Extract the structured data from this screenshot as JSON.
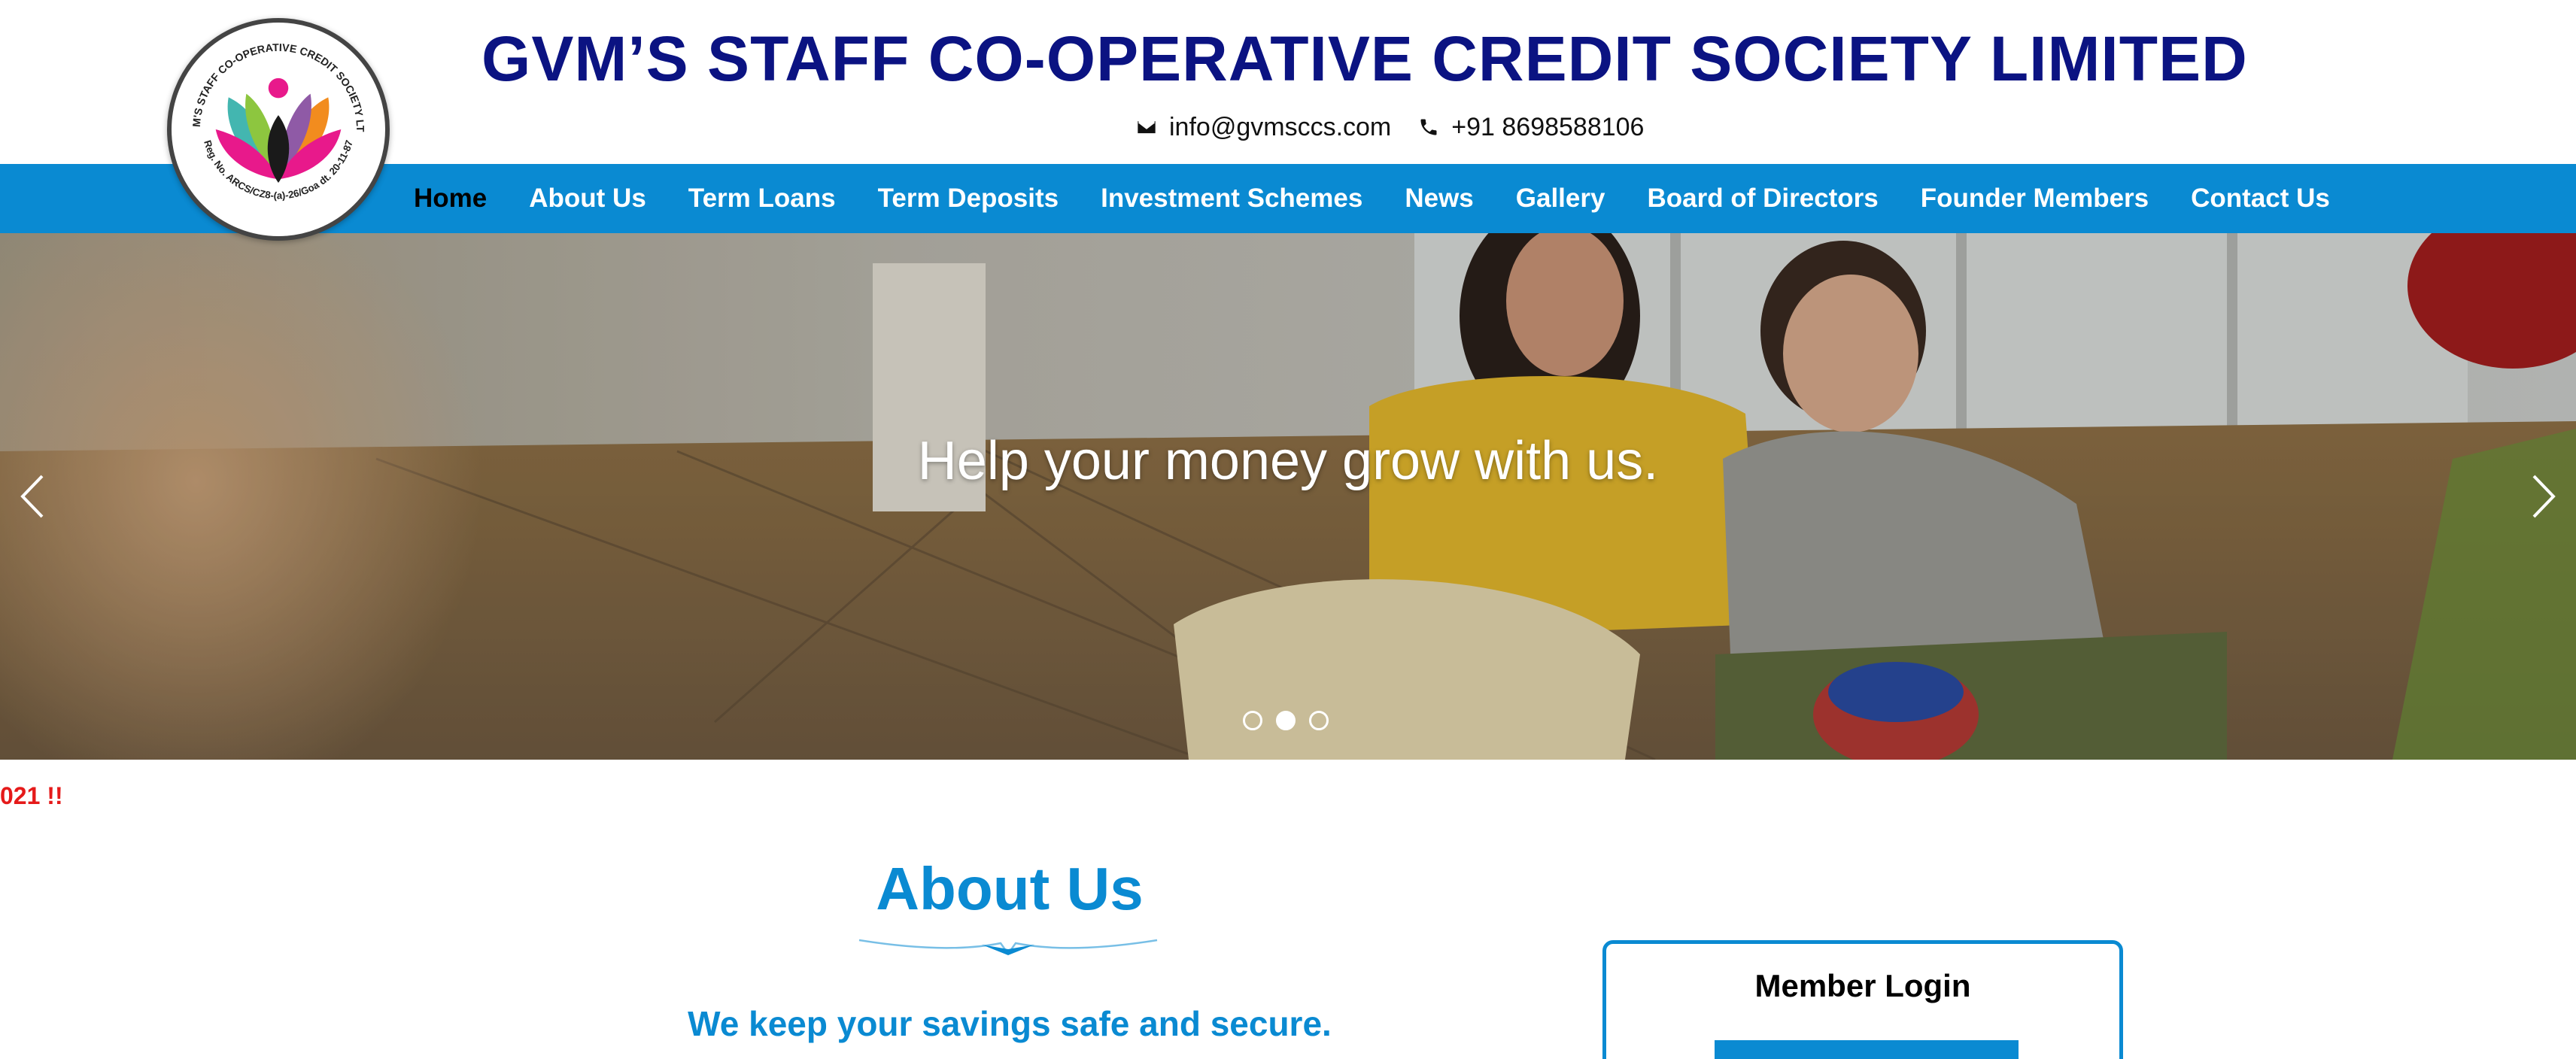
{
  "header": {
    "title": "GVM’S STAFF CO-OPERATIVE CREDIT SOCIETY LIMITED",
    "email": "info@gvmsccs.com",
    "phone": "+91 8698588106",
    "logo_text_top": "GVM'S STAFF CO-OPERATIVE CREDIT SOCIETY LTD.",
    "logo_text_bottom": "Reg. No. ARCS/CZ8-(a)-26/Goa dt. 20-11-87"
  },
  "nav": {
    "items": [
      {
        "label": "Home",
        "active": true
      },
      {
        "label": "About Us"
      },
      {
        "label": "Term Loans"
      },
      {
        "label": "Term Deposits"
      },
      {
        "label": "Investment Schemes"
      },
      {
        "label": "News"
      },
      {
        "label": "Gallery"
      },
      {
        "label": "Board of Directors"
      },
      {
        "label": "Founder Members"
      },
      {
        "label": "Contact Us"
      }
    ]
  },
  "hero": {
    "caption": "Help your money grow with us.",
    "slides": 3,
    "active_slide": 2
  },
  "marquee": {
    "text": "021 !!"
  },
  "about": {
    "title": "About Us",
    "subtitle": "We keep your savings safe and secure."
  },
  "login": {
    "title": "Member Login"
  },
  "colors": {
    "brand_blue": "#0a8ad2",
    "title_navy": "#0b1382",
    "marquee_red": "#e51a1a"
  },
  "icons": {
    "email": "envelope-icon",
    "phone": "phone-icon",
    "prev": "chevron-left-icon",
    "next": "chevron-right-icon"
  }
}
